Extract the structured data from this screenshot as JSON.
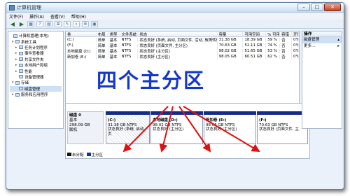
{
  "window": {
    "title": "计算机管理",
    "controls": {
      "minimize": "–",
      "maximize": "□",
      "close": "✕"
    }
  },
  "menubar": {
    "items": [
      "文件(F)",
      "操作(A)",
      "查看(V)",
      "帮助(H)"
    ]
  },
  "toolbar": {
    "back": "◀",
    "forward": "▶",
    "buttons": [
      "▦",
      "?",
      "▤",
      "⊞",
      "✎",
      "⌕",
      "☰",
      "▣"
    ]
  },
  "sidebar": {
    "items": [
      {
        "label": "计算机管理(本地)",
        "exp": ""
      },
      {
        "label": "系统工具",
        "exp": "▾"
      },
      {
        "label": "任务计划程序",
        "exp": "▸"
      },
      {
        "label": "事件查看器",
        "exp": "▸"
      },
      {
        "label": "共享文件夹",
        "exp": "▸"
      },
      {
        "label": "本地用户和组",
        "exp": "▸"
      },
      {
        "label": "性能",
        "exp": "▸"
      },
      {
        "label": "设备管理器",
        "exp": ""
      },
      {
        "label": "存储",
        "exp": "▾"
      },
      {
        "label": "磁盘管理",
        "exp": ""
      },
      {
        "label": "服务和应用程序",
        "exp": "▸"
      }
    ]
  },
  "volume_table": {
    "headers": [
      "卷",
      "布局",
      "类型",
      "文件系统",
      "状态",
      "容量",
      "可用空间",
      "% 可用",
      "容错",
      "开销"
    ],
    "rows": [
      [
        "(C:)",
        "简单",
        "基本",
        "NTFS",
        "状态良好 (系统, 启动, 页面文件, 活动, 故障转储, 主分区)",
        "31.38 GB",
        "18.39 GB",
        "59 %",
        "否",
        "0%"
      ],
      [
        "(F:)",
        "简单",
        "基本",
        "NTFS",
        "状态良好 (页面文件, 主分区)",
        "70.63 GB",
        "52.11 GB",
        "74 %",
        "否",
        "0%"
      ],
      [
        "本地磁盘 (D:)",
        "简单",
        "基本",
        "NTFS",
        "状态良好 (主分区)",
        "98.02 GB",
        "51.65 GB",
        "53 %",
        "否",
        "0%"
      ],
      [
        "新加卷 (E:)",
        "简单",
        "基本",
        "NTFS",
        "状态良好 (主分区)",
        "98.05 GB",
        "60.51 GB",
        "62 %",
        "否",
        "0%"
      ]
    ]
  },
  "disk": {
    "name": "磁盘 0",
    "type": "基本",
    "size": "298.09 GB",
    "status": "联机",
    "partitions": [
      {
        "label": "(C:)",
        "size": "31.38 GB NTFS",
        "status": "状态良好 (系统, 启动, 页"
      },
      {
        "label": "本地磁盘 (D:)",
        "size": "98.02 GB NTFS",
        "status": "状态良好 (主分区)"
      },
      {
        "label": "新加卷 (E:)",
        "size": "98.05 GB NTFS",
        "status": "状态良好 (主分区)"
      },
      {
        "label": "(F:)",
        "size": "70.63 GB NTFS",
        "status": "状态良好 (页面文件, 主"
      }
    ]
  },
  "legend": {
    "unallocated": "未分配",
    "primary": "主分区"
  },
  "actions": {
    "header": "操作",
    "items": [
      {
        "label": "磁盘管理",
        "arrow": "▴"
      },
      {
        "label": "更多...",
        "arrow": "▸"
      }
    ]
  },
  "annotation": {
    "text": "四个主分区",
    "color": "#1638c8",
    "arrow_color": "#e01010"
  }
}
